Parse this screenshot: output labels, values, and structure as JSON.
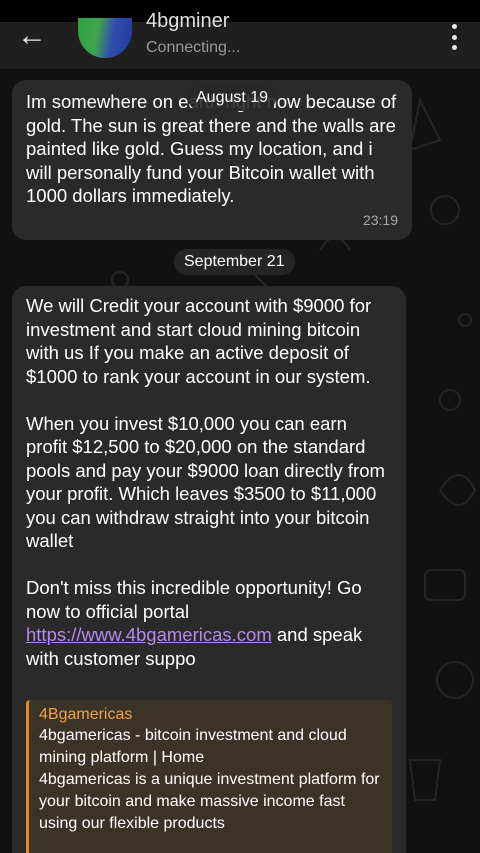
{
  "header": {
    "title": "4bgminer",
    "status": "Connecting...",
    "back_icon": "arrow-left-icon",
    "menu_icon": "more-vertical-icon"
  },
  "messages": [
    {
      "text": "Im somewhere on earth right now because of gold. The sun is great there and the walls are painted like gold. Guess my location, and i will personally fund your Bitcoin wallet with 1000 dollars immediately.",
      "time": "23:19",
      "date_overlay": "August 19"
    },
    {
      "date": "September 21",
      "text_part1": "We will Credit your account with $9000 for investment and start cloud mining bitcoin with us If you make an active deposit of $1000 to rank your account in our system.\n\nWhen you invest $10,000 you can earn profit $12,500 to $20,000 on the standard pools and pay your $9000 loan directly from your profit. Which leaves $3500 to $11,000 you can withdraw straight into your bitcoin wallet\n\nDon't miss this incredible opportunity! Go now to official portal ",
      "link": "https://www.4bgamericas.com",
      "text_part2": " and speak with customer suppo",
      "preview": {
        "site_name": "4Bgamericas",
        "title": "4bgamericas - bitcoin investment and cloud mining platform | Home",
        "description": "4bgamericas is a unique investment platform for your bitcoin and make massive income fast using our flexible products"
      }
    }
  ],
  "colors": {
    "bubble": "#2a2a2a",
    "link": "#b58af0",
    "preview_accent": "#e08a2d",
    "preview_bg": "#3c3327"
  }
}
